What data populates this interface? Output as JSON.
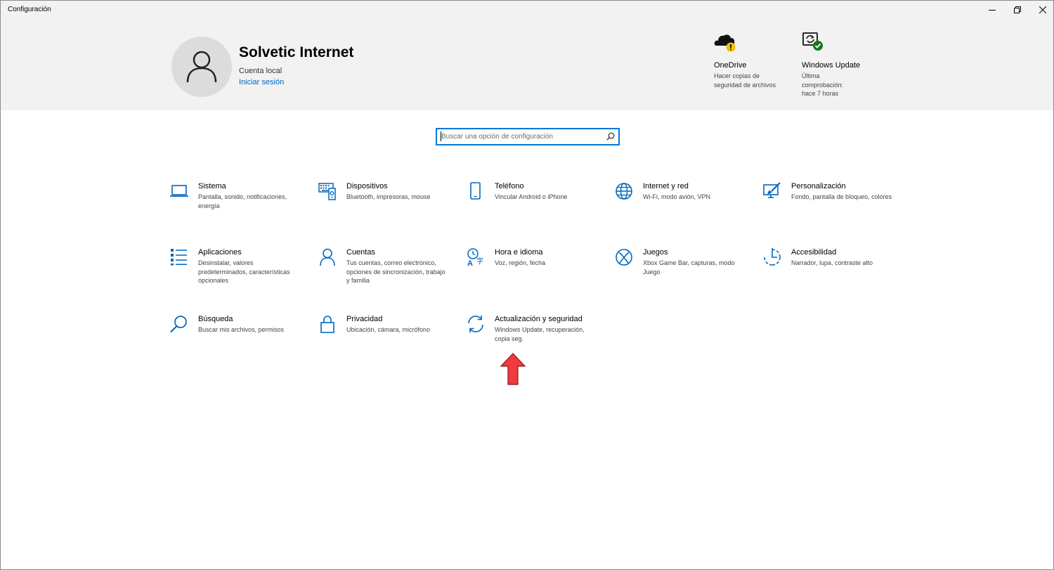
{
  "window": {
    "title": "Configuración"
  },
  "profile": {
    "name": "Solvetic Internet",
    "account_type": "Cuenta local",
    "sign_in_link": "Iniciar sesión"
  },
  "header_items": [
    {
      "title": "OneDrive",
      "desc": "Hacer copias de seguridad de archivos",
      "icon": "onedrive-cloud-warning-icon",
      "status_color": "#f2c200"
    },
    {
      "title": "Windows Update",
      "desc": "Última comprobación: hace 7 horas",
      "icon": "windows-update-ok-icon",
      "status_color": "#107c10"
    }
  ],
  "search": {
    "placeholder": "Buscar una opción de configuración"
  },
  "accent_color": "#0067c0",
  "categories": [
    {
      "title": "Sistema",
      "desc": "Pantalla, sonido, notificaciones, energía",
      "icon": "laptop-icon"
    },
    {
      "title": "Dispositivos",
      "desc": "Bluetooth, impresoras, mouse",
      "icon": "devices-icon"
    },
    {
      "title": "Teléfono",
      "desc": "Vincular Android o iPhone",
      "icon": "phone-icon"
    },
    {
      "title": "Internet y red",
      "desc": "Wi-Fi, modo avión, VPN",
      "icon": "globe-icon"
    },
    {
      "title": "Personalización",
      "desc": "Fondo, pantalla de bloqueo, colores",
      "icon": "paint-icon"
    },
    {
      "title": "Aplicaciones",
      "desc": "Desinstalar, valores predeterminados, características opcionales",
      "icon": "apps-list-icon"
    },
    {
      "title": "Cuentas",
      "desc": "Tus cuentas, correo electrónico, opciones de sincronización, trabajo y familia",
      "icon": "person-icon"
    },
    {
      "title": "Hora e idioma",
      "desc": "Voz, región, fecha",
      "icon": "time-language-icon"
    },
    {
      "title": "Juegos",
      "desc": "Xbox Game Bar, capturas, modo Juego",
      "icon": "xbox-icon"
    },
    {
      "title": "Accesibilidad",
      "desc": "Narrador, lupa, contraste alto",
      "icon": "accessibility-icon"
    },
    {
      "title": "Búsqueda",
      "desc": "Buscar mis archivos, permisos",
      "icon": "search-icon"
    },
    {
      "title": "Privacidad",
      "desc": "Ubicación, cámara, micrófono",
      "icon": "lock-icon"
    },
    {
      "title": "Actualización y seguridad",
      "desc": "Windows Update, recuperación, copia seg.",
      "icon": "sync-icon"
    }
  ],
  "annotation": {
    "icon": "red-up-arrow-icon",
    "color": "#f03a3e"
  }
}
